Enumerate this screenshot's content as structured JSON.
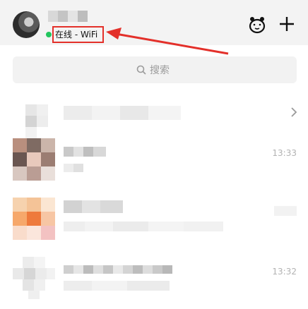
{
  "header": {
    "status": "在线 - WiFi",
    "icons": [
      "paw-icon",
      "plus-icon"
    ]
  },
  "search": {
    "placeholder": "搜索",
    "icon": "search-icon"
  },
  "conversations": [
    {
      "time": ""
    },
    {
      "time": "13:33"
    },
    {
      "time": ""
    },
    {
      "time": "13:32"
    }
  ],
  "colors": {
    "accent_red": "#e3302a",
    "online_green": "#22c55e",
    "header_bg": "#f3f3f3"
  }
}
